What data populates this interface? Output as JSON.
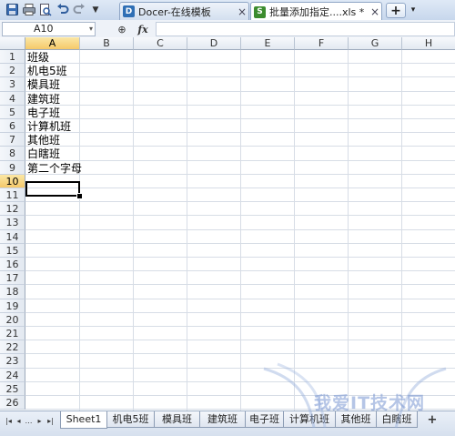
{
  "toolbar": {
    "icons": [
      "save-icon",
      "print-icon",
      "print-preview-icon",
      "undo-icon",
      "redo-icon",
      "customize-dropdown-icon"
    ]
  },
  "tabs": [
    {
      "label": "Docer-在线模板",
      "close": "×",
      "icon_text": "D",
      "icon_color": "#2f6fb5"
    },
    {
      "label": "批量添加指定....xls *",
      "close": "×",
      "icon_text": "S",
      "icon_color": "#3c8c2e"
    }
  ],
  "new_tab": {
    "label": "+",
    "arrow": "▾"
  },
  "formula_bar": {
    "name_box": "A10",
    "name_arrow": "▾",
    "zoom_icon": "⊕",
    "fx_label": "fx",
    "value": ""
  },
  "grid": {
    "columns": [
      "A",
      "B",
      "C",
      "D",
      "E",
      "F",
      "G",
      "H"
    ],
    "selected_column": "A",
    "rows": [
      "1",
      "2",
      "3",
      "4",
      "5",
      "6",
      "7",
      "8",
      "9",
      "10",
      "11",
      "12",
      "13",
      "14",
      "15",
      "16",
      "17",
      "18",
      "19",
      "20",
      "21",
      "22",
      "23",
      "24",
      "25",
      "26"
    ],
    "selected_row": "10",
    "cells_A": [
      "班级",
      "机电5班",
      "模具班",
      "建筑班",
      "电子班",
      "计算机班",
      "其他班",
      "白瞎班",
      "第二个字母"
    ]
  },
  "sheet_bar": {
    "nav": [
      "|◂",
      "◂",
      "…",
      "▸",
      "▸|"
    ],
    "tabs": [
      "Sheet1",
      "机电5班",
      "模具班",
      "建筑班",
      "电子班",
      "计算机班",
      "其他班",
      "白瞎班"
    ],
    "active": "Sheet1",
    "add": "+"
  },
  "watermark": {
    "text": "我爱IT技术网"
  },
  "colors": {
    "accent": "#f5c96a",
    "chrome": "#dfe9f6",
    "grid_line": "#d7dde6"
  }
}
